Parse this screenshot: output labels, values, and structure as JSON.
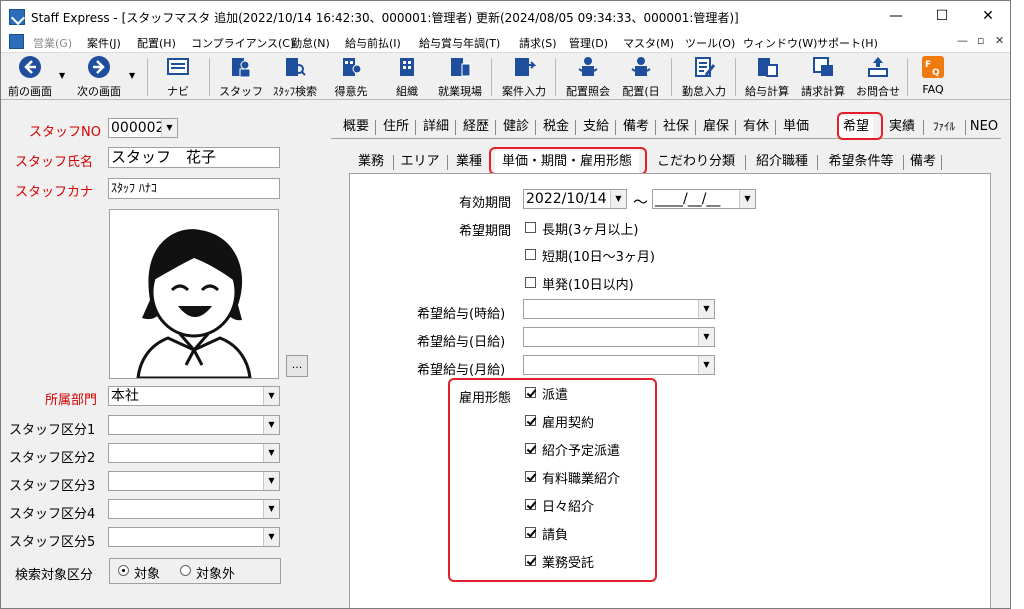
{
  "window": {
    "title": "Staff Express - [スタッフマスタ 追加(2022/10/14 16:42:30、000001:管理者) 更新(2024/08/05 09:34:33、000001:管理者)]",
    "min_glyph": "—",
    "max_glyph": "☐",
    "close_glyph": "✕"
  },
  "menu": {
    "items": [
      "営業(G)",
      "案件(J)",
      "配置(H)",
      "コンプライアンス(C)",
      "勤怠(N)",
      "給与前払(I)",
      "給与賞与年調(T)",
      "請求(S)",
      "管理(D)",
      "マスタ(M)",
      "ツール(O)",
      "ウィンドウ(W)",
      "サポート(H)"
    ],
    "mdi_min": "—",
    "mdi_restore": "▫",
    "mdi_close": "✕"
  },
  "toolbar": {
    "prev": "前の画面",
    "next": "次の画面",
    "navi": "ナビ",
    "staff": "スタッフ",
    "staff_search": "ｽﾀｯﾌ検索",
    "client": "得意先",
    "org": "組織",
    "site": "就業現場",
    "job_entry": "案件入力",
    "placement_inquiry": "配置照会",
    "placement_day": "配置(日",
    "attendance": "勤怠入力",
    "payroll": "給与計算",
    "billing": "請求計算",
    "contact": "お問合せ",
    "faq": "FAQ"
  },
  "left": {
    "staff_no_label": "スタッフNO",
    "staff_no": "000002",
    "name_label": "スタッフ氏名",
    "name": "スタッフ　花子",
    "kana_label": "スタッフカナ",
    "kana": "ｽﾀｯﾌ ﾊﾅｺ",
    "photo_button": "...",
    "dept_label": "所属部門",
    "dept": "本社",
    "cat1_label": "スタッフ区分1",
    "cat2_label": "スタッフ区分2",
    "cat3_label": "スタッフ区分3",
    "cat4_label": "スタッフ区分4",
    "cat5_label": "スタッフ区分5",
    "search_label": "検索対象区分",
    "radio_on": "対象",
    "radio_off": "対象外"
  },
  "main_tabs": [
    "概要",
    "住所",
    "詳細",
    "経歴",
    "健診",
    "税金",
    "支給",
    "備考",
    "社保",
    "雇保",
    "有休",
    "単価",
    "希望",
    "実績",
    "ﾌｧｲﾙ",
    "NEO"
  ],
  "sub_tabs": [
    "業務",
    "エリア",
    "業種",
    "単価・期間・雇用形態",
    "こだわり分類",
    "紹介職種",
    "希望条件等",
    "備考"
  ],
  "form": {
    "valid_period_label": "有効期間",
    "valid_from": "2022/10/14",
    "tilde": "～",
    "valid_to": "____/__/__",
    "desired_period_label": "希望期間",
    "period_long": "長期(3ヶ月以上)",
    "period_short": "短期(10日～3ヶ月)",
    "period_once": "単発(10日以内)",
    "wage_hour_label": "希望給与(時給)",
    "wage_day_label": "希望給与(日給)",
    "wage_month_label": "希望給与(月給)",
    "employment_label": "雇用形態",
    "emp_1": "派遣",
    "emp_2": "雇用契約",
    "emp_3": "紹介予定派遣",
    "emp_4": "有料職業紹介",
    "emp_5": "日々紹介",
    "emp_6": "請負",
    "emp_7": "業務受託"
  },
  "colors": {
    "accent_red": "#e3202a",
    "label_red": "#d40000"
  }
}
